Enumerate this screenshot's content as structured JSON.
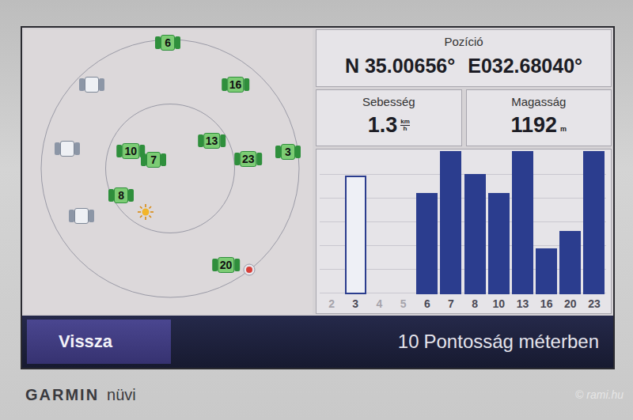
{
  "device": {
    "brand": "GARMIN",
    "model": "nüvi",
    "watermark": "© rami.hu"
  },
  "position": {
    "label": "Pozíció",
    "latitude": "N 35.00656°",
    "longitude": "E032.68040°"
  },
  "speed": {
    "label": "Sebesség",
    "value": "1.3",
    "unit_top": "km",
    "unit_bottom": "h"
  },
  "elevation": {
    "label": "Magasság",
    "value": "1192",
    "unit": "m"
  },
  "sky": {
    "satellites": [
      {
        "label": "6",
        "tracked": true,
        "azimuth": 359,
        "elevation": 2
      },
      {
        "label": "",
        "tracked": false,
        "azimuth": 317,
        "elevation": 10
      },
      {
        "label": "",
        "tracked": false,
        "azimuth": 281,
        "elevation": 17
      },
      {
        "label": "",
        "tracked": false,
        "azimuth": 242,
        "elevation": 20
      },
      {
        "label": "16",
        "tracked": true,
        "azimuth": 38,
        "elevation": 16
      },
      {
        "label": "13",
        "tracked": true,
        "azimuth": 56,
        "elevation": 55
      },
      {
        "label": "10",
        "tracked": true,
        "azimuth": 294,
        "elevation": 60
      },
      {
        "label": "7",
        "tracked": true,
        "azimuth": 298,
        "elevation": 77
      },
      {
        "label": "23",
        "tracked": true,
        "azimuth": 83,
        "elevation": 35
      },
      {
        "label": "3",
        "tracked": true,
        "azimuth": 82,
        "elevation": 7
      },
      {
        "label": "8",
        "tracked": true,
        "azimuth": 241,
        "elevation": 51
      },
      {
        "label": "20",
        "tracked": true,
        "azimuth": 150,
        "elevation": 12
      }
    ],
    "markers": [
      {
        "kind": "sun",
        "azimuth": 209,
        "elevation": 55
      },
      {
        "kind": "moon",
        "azimuth": 142,
        "elevation": 0
      }
    ]
  },
  "signal": {
    "bars": [
      {
        "label": "2",
        "active": false,
        "filled": false,
        "level": 0
      },
      {
        "label": "3",
        "active": true,
        "filled": false,
        "level": 0.83
      },
      {
        "label": "4",
        "active": false,
        "filled": false,
        "level": 0
      },
      {
        "label": "5",
        "active": false,
        "filled": false,
        "level": 0
      },
      {
        "label": "6",
        "active": true,
        "filled": true,
        "level": 0.71
      },
      {
        "label": "7",
        "active": true,
        "filled": true,
        "level": 1.0
      },
      {
        "label": "8",
        "active": true,
        "filled": true,
        "level": 0.84
      },
      {
        "label": "10",
        "active": true,
        "filled": true,
        "level": 0.71
      },
      {
        "label": "13",
        "active": true,
        "filled": true,
        "level": 1.0
      },
      {
        "label": "16",
        "active": true,
        "filled": true,
        "level": 0.32
      },
      {
        "label": "20",
        "active": true,
        "filled": true,
        "level": 0.44
      },
      {
        "label": "23",
        "active": true,
        "filled": true,
        "level": 1.0
      }
    ]
  },
  "footer": {
    "back_button": "Vissza",
    "accuracy_value": "10",
    "accuracy_label": "Pontosság méterben"
  }
}
